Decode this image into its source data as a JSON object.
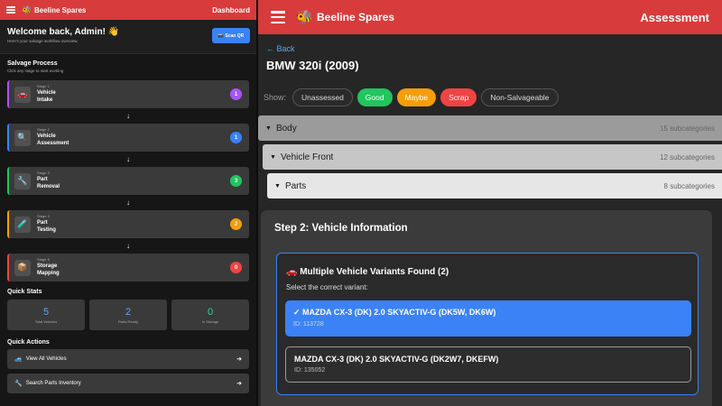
{
  "brand": "Beeline Spares",
  "left": {
    "header": {
      "page": "Dashboard"
    },
    "welcome": {
      "title": "Welcome back, Admin! 👋",
      "subtitle": "Here's your salvage workflow overview.",
      "scan_label": "📷 Scan QR"
    },
    "salvage": {
      "title": "Salvage Process",
      "subtitle": "Click any stage to start working",
      "stages": [
        {
          "num": "Stage 1",
          "name": "Vehicle Intake",
          "count": "1",
          "icon": "car-icon",
          "glyph": "🚗",
          "color": "#a855f7"
        },
        {
          "num": "Stage 2",
          "name": "Vehicle Assessment",
          "count": "1",
          "icon": "magnifier-icon",
          "glyph": "🔍",
          "color": "#3b82f6"
        },
        {
          "num": "Stage 3",
          "name": "Part Removal",
          "count": "3",
          "icon": "wrench-icon",
          "glyph": "🔧",
          "color": "#22c55e"
        },
        {
          "num": "Stage 4",
          "name": "Part Testing",
          "count": "2",
          "icon": "test-tube-icon",
          "glyph": "🧪",
          "color": "#f59e0b"
        },
        {
          "num": "Stage 5",
          "name": "Storage Mapping",
          "count": "0",
          "icon": "box-icon",
          "glyph": "📦",
          "color": "#ef4444"
        }
      ]
    },
    "quick_stats": {
      "title": "Quick Stats",
      "items": [
        {
          "value": "5",
          "label": "Total Vehicles"
        },
        {
          "value": "2",
          "label": "Parts Ready"
        },
        {
          "value": "0",
          "label": "In Storage"
        }
      ]
    },
    "quick_actions": {
      "title": "Quick Actions",
      "items": [
        {
          "label": "View All Vehicles",
          "icon": "truck-icon",
          "glyph": "🚙"
        },
        {
          "label": "Search Parts Inventory",
          "icon": "wrench-icon",
          "glyph": "🔧"
        }
      ]
    }
  },
  "right": {
    "header": {
      "page": "Assessment"
    },
    "back_label": "← Back",
    "vehicle_title": "BMW 320i (2009)",
    "filters": {
      "label": "Show:",
      "items": [
        {
          "label": "Unassessed",
          "color": "#2a2a2a"
        },
        {
          "label": "Good",
          "color": "#22c55e"
        },
        {
          "label": "Maybe",
          "color": "#f59e0b"
        },
        {
          "label": "Scrap",
          "color": "#ef4444"
        },
        {
          "label": "Non-Salvageable",
          "color": "#2a2a2a"
        }
      ]
    },
    "categories": [
      {
        "name": "Body",
        "count": "15 subcategories"
      },
      {
        "name": "Vehicle Front",
        "count": "12 subcategories"
      },
      {
        "name": "Parts",
        "count": "8 subcategories"
      }
    ],
    "modal": {
      "step_title": "Step 2: Vehicle Information",
      "variants_heading": "🚗 Multiple Vehicle Variants Found (2)",
      "select_prompt": "Select the correct variant:",
      "variants": [
        {
          "name": "✓ MAZDA CX-3 (DK) 2.0 SKYACTIV-G (DK5W, DK6W)",
          "id": "ID: 113728",
          "selected": true
        },
        {
          "name": "MAZDA CX-3 (DK) 2.0 SKYACTIV-G (DK2W7, DKEFW)",
          "id": "ID: 135052",
          "selected": false
        }
      ]
    }
  }
}
